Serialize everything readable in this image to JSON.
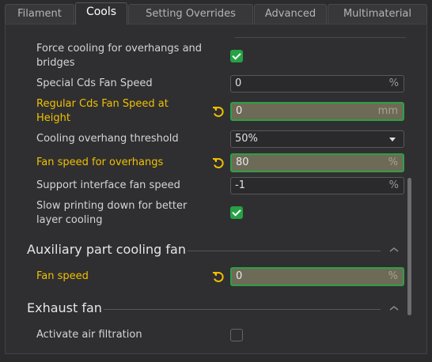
{
  "tabs": [
    {
      "label": "Filament"
    },
    {
      "label": "Cools"
    },
    {
      "label": "Setting Overrides"
    },
    {
      "label": "Advanced"
    },
    {
      "label": "Multimaterial"
    }
  ],
  "active_tab": "Cools",
  "rows": {
    "force_cooling": {
      "label": "Force cooling for overhangs and bridges",
      "line1": "Force cooling for overhangs and",
      "line2": "bridges",
      "checked": true
    },
    "special_cds": {
      "label": "Special Cds Fan Speed",
      "value": "0",
      "unit": "%"
    },
    "regular_cds": {
      "line1": "Regular Cds Fan Speed at",
      "line2": "Height",
      "value": "0",
      "unit": "mm",
      "modified": true
    },
    "overhang_threshold": {
      "label": "Cooling overhang threshold",
      "value": "50%"
    },
    "fan_speed_overhangs": {
      "label": "Fan speed for overhangs",
      "value": "80",
      "unit": "%",
      "modified": true
    },
    "support_interface": {
      "label": "Support interface fan speed",
      "value": "-1",
      "unit": "%"
    },
    "slow_printing": {
      "line1": "Slow printing down for better",
      "line2": "layer cooling",
      "checked": true
    }
  },
  "aux_section": {
    "title": "Auxiliary part cooling fan",
    "fan_speed": {
      "label": "Fan speed",
      "value": "0",
      "unit": "%",
      "modified": true
    }
  },
  "exhaust_section": {
    "title": "Exhaust fan",
    "air_filtration": {
      "label": "Activate air filtration",
      "checked": false
    }
  },
  "colors": {
    "modified_label": "#f0c000",
    "checkbox_on": "#25a244",
    "modified_border": "#2ea043",
    "modified_fill": "#6e6a58",
    "reset_icon": "#f0c000"
  }
}
